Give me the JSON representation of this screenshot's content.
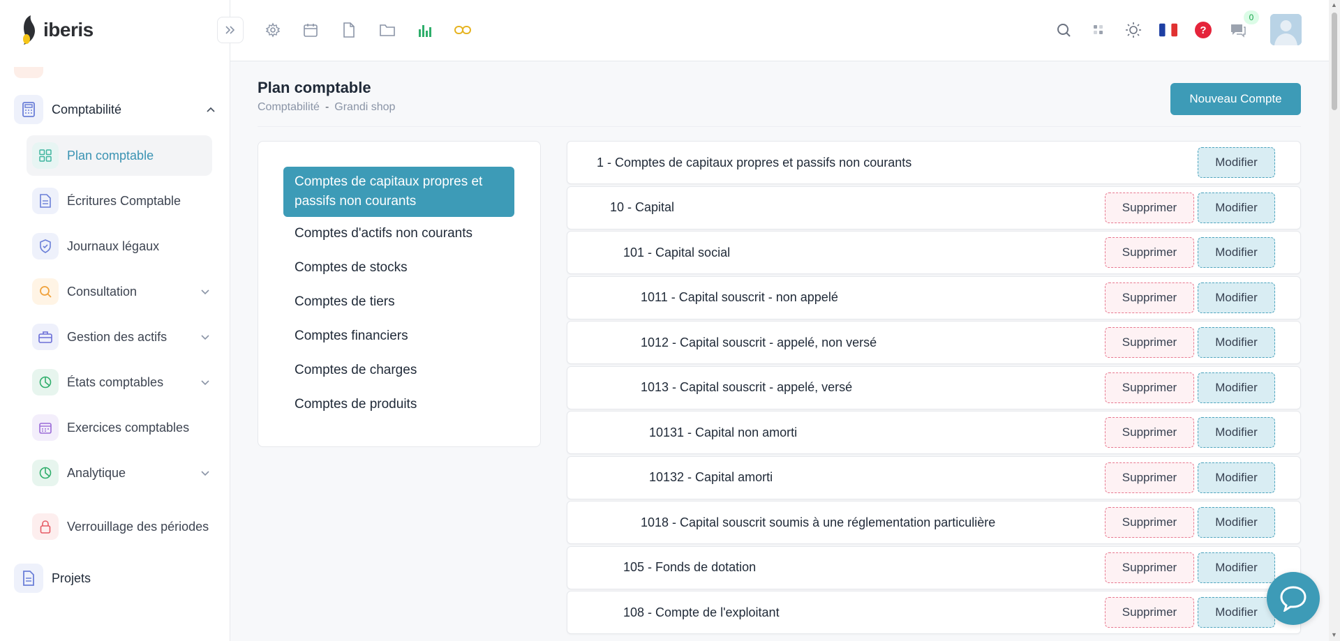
{
  "app": {
    "brand": "iberis"
  },
  "sidebar": {
    "section": {
      "label": "Comptabilité",
      "icon": "calculator-icon"
    },
    "items": [
      {
        "label": "Plan comptable",
        "icon": "grid-icon",
        "active": true,
        "chevron": false,
        "icon_bg": "#e7f5f3",
        "icon_color": "#3fb59f"
      },
      {
        "label": "Écritures Comptable",
        "icon": "document-icon",
        "active": false,
        "chevron": false,
        "icon_bg": "#eef1fb",
        "icon_color": "#6b7fd8"
      },
      {
        "label": "Journaux légaux",
        "icon": "shield-icon",
        "active": false,
        "chevron": false,
        "icon_bg": "#eef1fb",
        "icon_color": "#6b7fd8"
      },
      {
        "label": "Consultation",
        "icon": "search-icon",
        "active": false,
        "chevron": true,
        "icon_bg": "#fff4e5",
        "icon_color": "#f0a23c"
      },
      {
        "label": "Gestion des actifs",
        "icon": "briefcase-icon",
        "active": false,
        "chevron": true,
        "icon_bg": "#eef0fb",
        "icon_color": "#6b6fd8"
      },
      {
        "label": "États comptables",
        "icon": "pie-chart-icon",
        "active": false,
        "chevron": true,
        "icon_bg": "#e7f5ee",
        "icon_color": "#2fae6b"
      },
      {
        "label": "Exercices comptables",
        "icon": "calendar-icon",
        "active": false,
        "chevron": false,
        "icon_bg": "#f3eefb",
        "icon_color": "#9b6bd8"
      },
      {
        "label": "Analytique",
        "icon": "pie-chart-icon",
        "active": false,
        "chevron": true,
        "icon_bg": "#e7f5ee",
        "icon_color": "#2fae6b"
      },
      {
        "label": "Verrouillage des périodes",
        "icon": "lock-icon",
        "active": false,
        "chevron": false,
        "icon_bg": "#fdeeee",
        "icon_color": "#e65a64"
      }
    ],
    "projets": {
      "label": "Projets",
      "icon": "file-icon"
    }
  },
  "topbar": {
    "icons": [
      "settings-icon",
      "calendar-icon",
      "file-icon",
      "folder-icon",
      "bar-chart-icon",
      "link-icon"
    ],
    "right_icons": [
      "search-icon",
      "apps-icon",
      "theme-icon",
      "flag-fr-icon",
      "help-icon",
      "chat-icon"
    ],
    "notifications_count": "0"
  },
  "page": {
    "title": "Plan comptable",
    "breadcrumb": [
      "Comptabilité",
      "Grandi shop"
    ],
    "breadcrumb_sep": "-",
    "new_button": "Nouveau Compte"
  },
  "categories": [
    {
      "label": "Comptes de capitaux propres et passifs non courants",
      "active": true
    },
    {
      "label": "Comptes d'actifs non courants",
      "active": false
    },
    {
      "label": "Comptes de stocks",
      "active": false
    },
    {
      "label": "Comptes de tiers",
      "active": false
    },
    {
      "label": "Comptes financiers",
      "active": false
    },
    {
      "label": "Comptes de charges",
      "active": false
    },
    {
      "label": "Comptes de produits",
      "active": false
    }
  ],
  "accounts": [
    {
      "label": "1 - Comptes de capitaux propres et passifs non courants",
      "level": 0,
      "deletable": false
    },
    {
      "label": "10 - Capital",
      "level": 1,
      "deletable": true
    },
    {
      "label": "101 - Capital social",
      "level": 2,
      "deletable": true
    },
    {
      "label": "1011 - Capital souscrit - non appelé",
      "level": 3,
      "deletable": true
    },
    {
      "label": "1012 - Capital souscrit - appelé, non versé",
      "level": 3,
      "deletable": true
    },
    {
      "label": "1013 - Capital souscrit - appelé, versé",
      "level": 3,
      "deletable": true
    },
    {
      "label": "10131 - Capital non amorti",
      "level": 4,
      "deletable": true
    },
    {
      "label": "10132 - Capital amorti",
      "level": 4,
      "deletable": true
    },
    {
      "label": "1018 - Capital souscrit soumis à une réglementation particulière",
      "level": 3,
      "deletable": true
    },
    {
      "label": "105 - Fonds de dotation",
      "level": 2,
      "deletable": true
    },
    {
      "label": "108 - Compte de l'exploitant",
      "level": 2,
      "deletable": true
    }
  ],
  "actions": {
    "delete": "Supprimer",
    "edit": "Modifier"
  },
  "colors": {
    "accent": "#3d9bb7",
    "danger_border": "#e8788f",
    "danger_bg": "#fef2f4"
  }
}
